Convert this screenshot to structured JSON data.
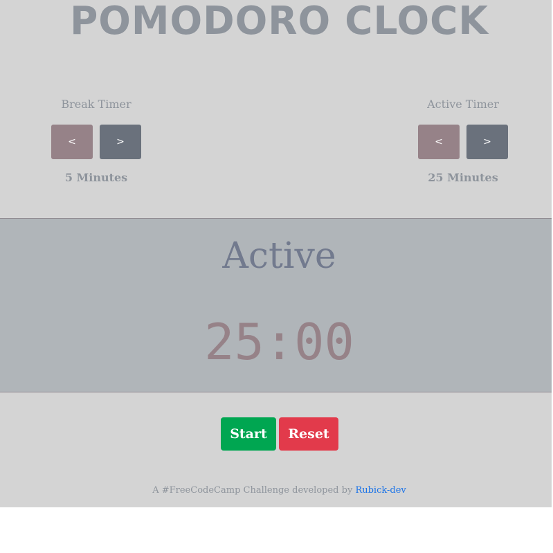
{
  "header": {
    "title": "Pomodoro Clock"
  },
  "break_timer": {
    "label": "Break Timer",
    "decrement_label": "<",
    "increment_label": ">",
    "value": "5 Minutes"
  },
  "active_timer": {
    "label": "Active Timer",
    "decrement_label": "<",
    "increment_label": ">",
    "value": "25 Minutes"
  },
  "display": {
    "session": "Active",
    "time": "25:00"
  },
  "controls": {
    "start_label": "Start",
    "reset_label": "Reset"
  },
  "footer": {
    "text": "A #FreeCodeCamp Challenge developed by ",
    "link_text": "Rubick-dev"
  },
  "colors": {
    "background": "#d4d4d4",
    "display_background": "#b0b5b9",
    "start": "#00a651",
    "reset": "#e23a4b",
    "decrement": "#968288",
    "increment": "#6a717c",
    "link": "#1a73e8"
  }
}
